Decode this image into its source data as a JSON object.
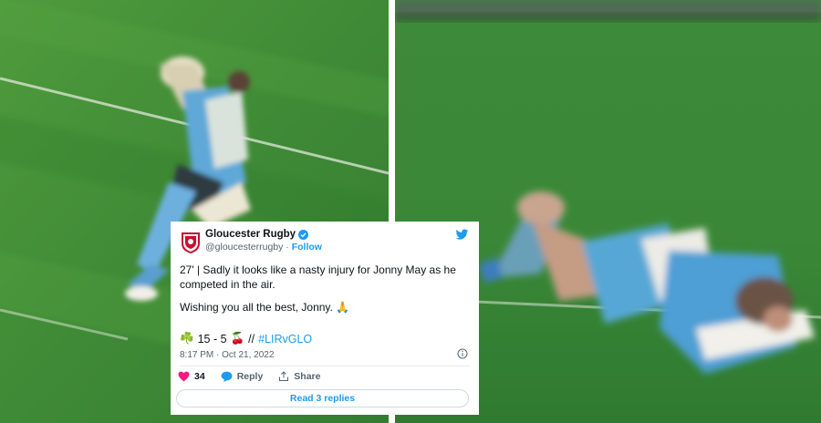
{
  "tweet": {
    "display_name": "Gloucester Rugby",
    "handle": "@gloucesterrugby",
    "follow_label": "Follow",
    "body_line1": "27' | Sadly it looks like a nasty injury for Jonny May as he competed in the air.",
    "body_line2": "Wishing you all the best, Jonny. 🙏",
    "score_left_emoji": "☘️",
    "score": "15 - 5",
    "score_right_emoji": "🍒",
    "score_sep": "//",
    "hashtag": "#LIRvGLO",
    "timestamp": "8:17 PM · Oct 21, 2022",
    "like_count": "34",
    "reply_label": "Reply",
    "share_label": "Share",
    "read_replies_label": "Read 3 replies"
  },
  "colors": {
    "pitch": "#3f8f3a",
    "pitch_dark": "#2e7a2f",
    "link": "#1d9bf0",
    "like": "#f91880",
    "kit_blue": "#4a9ed6"
  },
  "icons": [
    "gloucester-crest-icon",
    "verified-badge-icon",
    "twitter-bird-icon",
    "info-icon",
    "heart-icon",
    "reply-bubble-icon",
    "share-icon"
  ]
}
